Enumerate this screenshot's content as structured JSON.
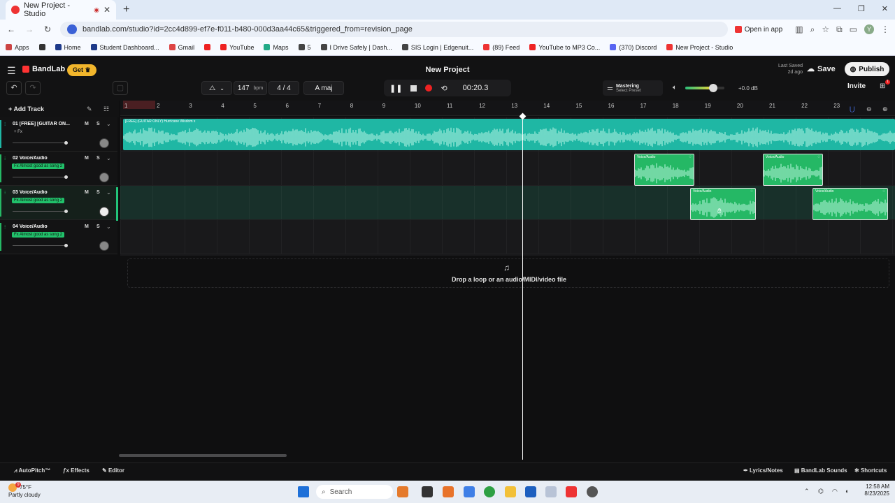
{
  "browser": {
    "tab_title": "New Project - Studio",
    "url": "bandlab.com/studio?id=2cc4d899-ef7e-f011-b480-000d3aa44c65&triggered_from=revision_page",
    "open_in_app": "Open in app",
    "profile_initial": "Y",
    "bookmarks": [
      "Apps",
      "Home",
      "Student Dashboard...",
      "Gmail",
      "YouTube",
      "Maps",
      "5",
      "I Drive Safely | Dash...",
      "SIS Login | Edgenuit...",
      "(89) Feed",
      "YouTube to MP3 Co...",
      "(370) Discord",
      "New Project - Studio"
    ]
  },
  "header": {
    "brand": "BandLab",
    "get_label": "Get",
    "project_title": "New Project",
    "last_saved_line1": "Last Saved",
    "last_saved_line2": "2d ago",
    "save_label": "Save",
    "publish_label": "Publish",
    "invite_label": "Invite",
    "notification_count": "1",
    "tempo": "147",
    "tempo_unit": "bpm",
    "time_signature": "4 / 4",
    "key": "A maj",
    "time": "00:20.3",
    "mastering_title": "Mastering",
    "mastering_preset": "Select Preset",
    "master_gain": "+0.0 dB",
    "master_volume_fraction": 0.68
  },
  "toolbar": {
    "add_track": "Add Track"
  },
  "ruler": {
    "bars": [
      "1",
      "2",
      "3",
      "4",
      "5",
      "6",
      "7",
      "8",
      "9",
      "10",
      "11",
      "12",
      "13",
      "14",
      "15",
      "16",
      "17",
      "18",
      "19",
      "20",
      "21",
      "22",
      "23"
    ]
  },
  "tracks": [
    {
      "number": "01",
      "name": "[FREE] [GUITAR ON...",
      "fx": "+ Fx",
      "fx_active": false,
      "mute": "M",
      "solo": "S",
      "color": "#1fb7a4",
      "volume_fraction": 0.94,
      "selected": false
    },
    {
      "number": "02",
      "name": "Voice/Audio",
      "fx": "Fx Almost good as song 2",
      "fx_active": true,
      "mute": "M",
      "solo": "S",
      "color": "#25b865",
      "volume_fraction": 0.94,
      "selected": false
    },
    {
      "number": "03",
      "name": "Voice/Audio",
      "fx": "Fx Almost good as song 2",
      "fx_active": true,
      "mute": "M",
      "solo": "S",
      "color": "#25b865",
      "volume_fraction": 0.94,
      "selected": true
    },
    {
      "number": "04",
      "name": "Voice/Audio",
      "fx": "Fx Almost good as song 2",
      "fx_active": true,
      "mute": "M",
      "solo": "S",
      "color": "#25b865",
      "volume_fraction": 0.94,
      "selected": false
    }
  ],
  "clips": {
    "guitar_label": "[FREE] (GUITAR ONLY) Hurricane Wisdom x",
    "voice_label": "Voice/Audio"
  },
  "dropzone": {
    "text": "Drop a loop or an audio/MIDI/video file"
  },
  "bottom": {
    "autopitch": "AutoPitch™",
    "effects": "Effects",
    "editor": "Editor",
    "lyrics": "Lyrics/Notes",
    "sounds": "BandLab Sounds",
    "shortcuts": "Shortcuts"
  },
  "taskbar": {
    "temperature": "75°F",
    "weather": "Partly cloudy",
    "weather_badge": "9",
    "search": "Search",
    "time": "12:58 AM",
    "date": "8/23/2025"
  },
  "colors": {
    "accent_green": "#25b865",
    "accent_teal": "#1fb7a4",
    "record_red": "#e22222",
    "get_yellow": "#f2b62c"
  }
}
